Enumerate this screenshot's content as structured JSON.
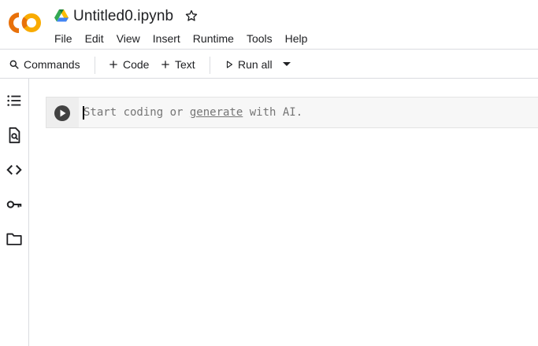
{
  "header": {
    "logo_text": "CO",
    "title": "Untitled0.ipynb",
    "menu": [
      "File",
      "Edit",
      "View",
      "Insert",
      "Runtime",
      "Tools",
      "Help"
    ]
  },
  "toolbar": {
    "commands_label": "Commands",
    "add_code_label": "Code",
    "add_text_label": "Text",
    "run_all_label": "Run all"
  },
  "sidebar": {
    "items": [
      "toc-icon",
      "find-icon",
      "code-snippets-icon",
      "secrets-key-icon",
      "files-folder-icon"
    ]
  },
  "cell": {
    "placeholder_before": "Start coding or ",
    "placeholder_link": "generate",
    "placeholder_after": " with AI."
  },
  "colors": {
    "logo_orange": "#F9AB00",
    "logo_dark_orange": "#E8710A",
    "border": "#dadce0",
    "cell_bg": "#f7f7f7"
  }
}
